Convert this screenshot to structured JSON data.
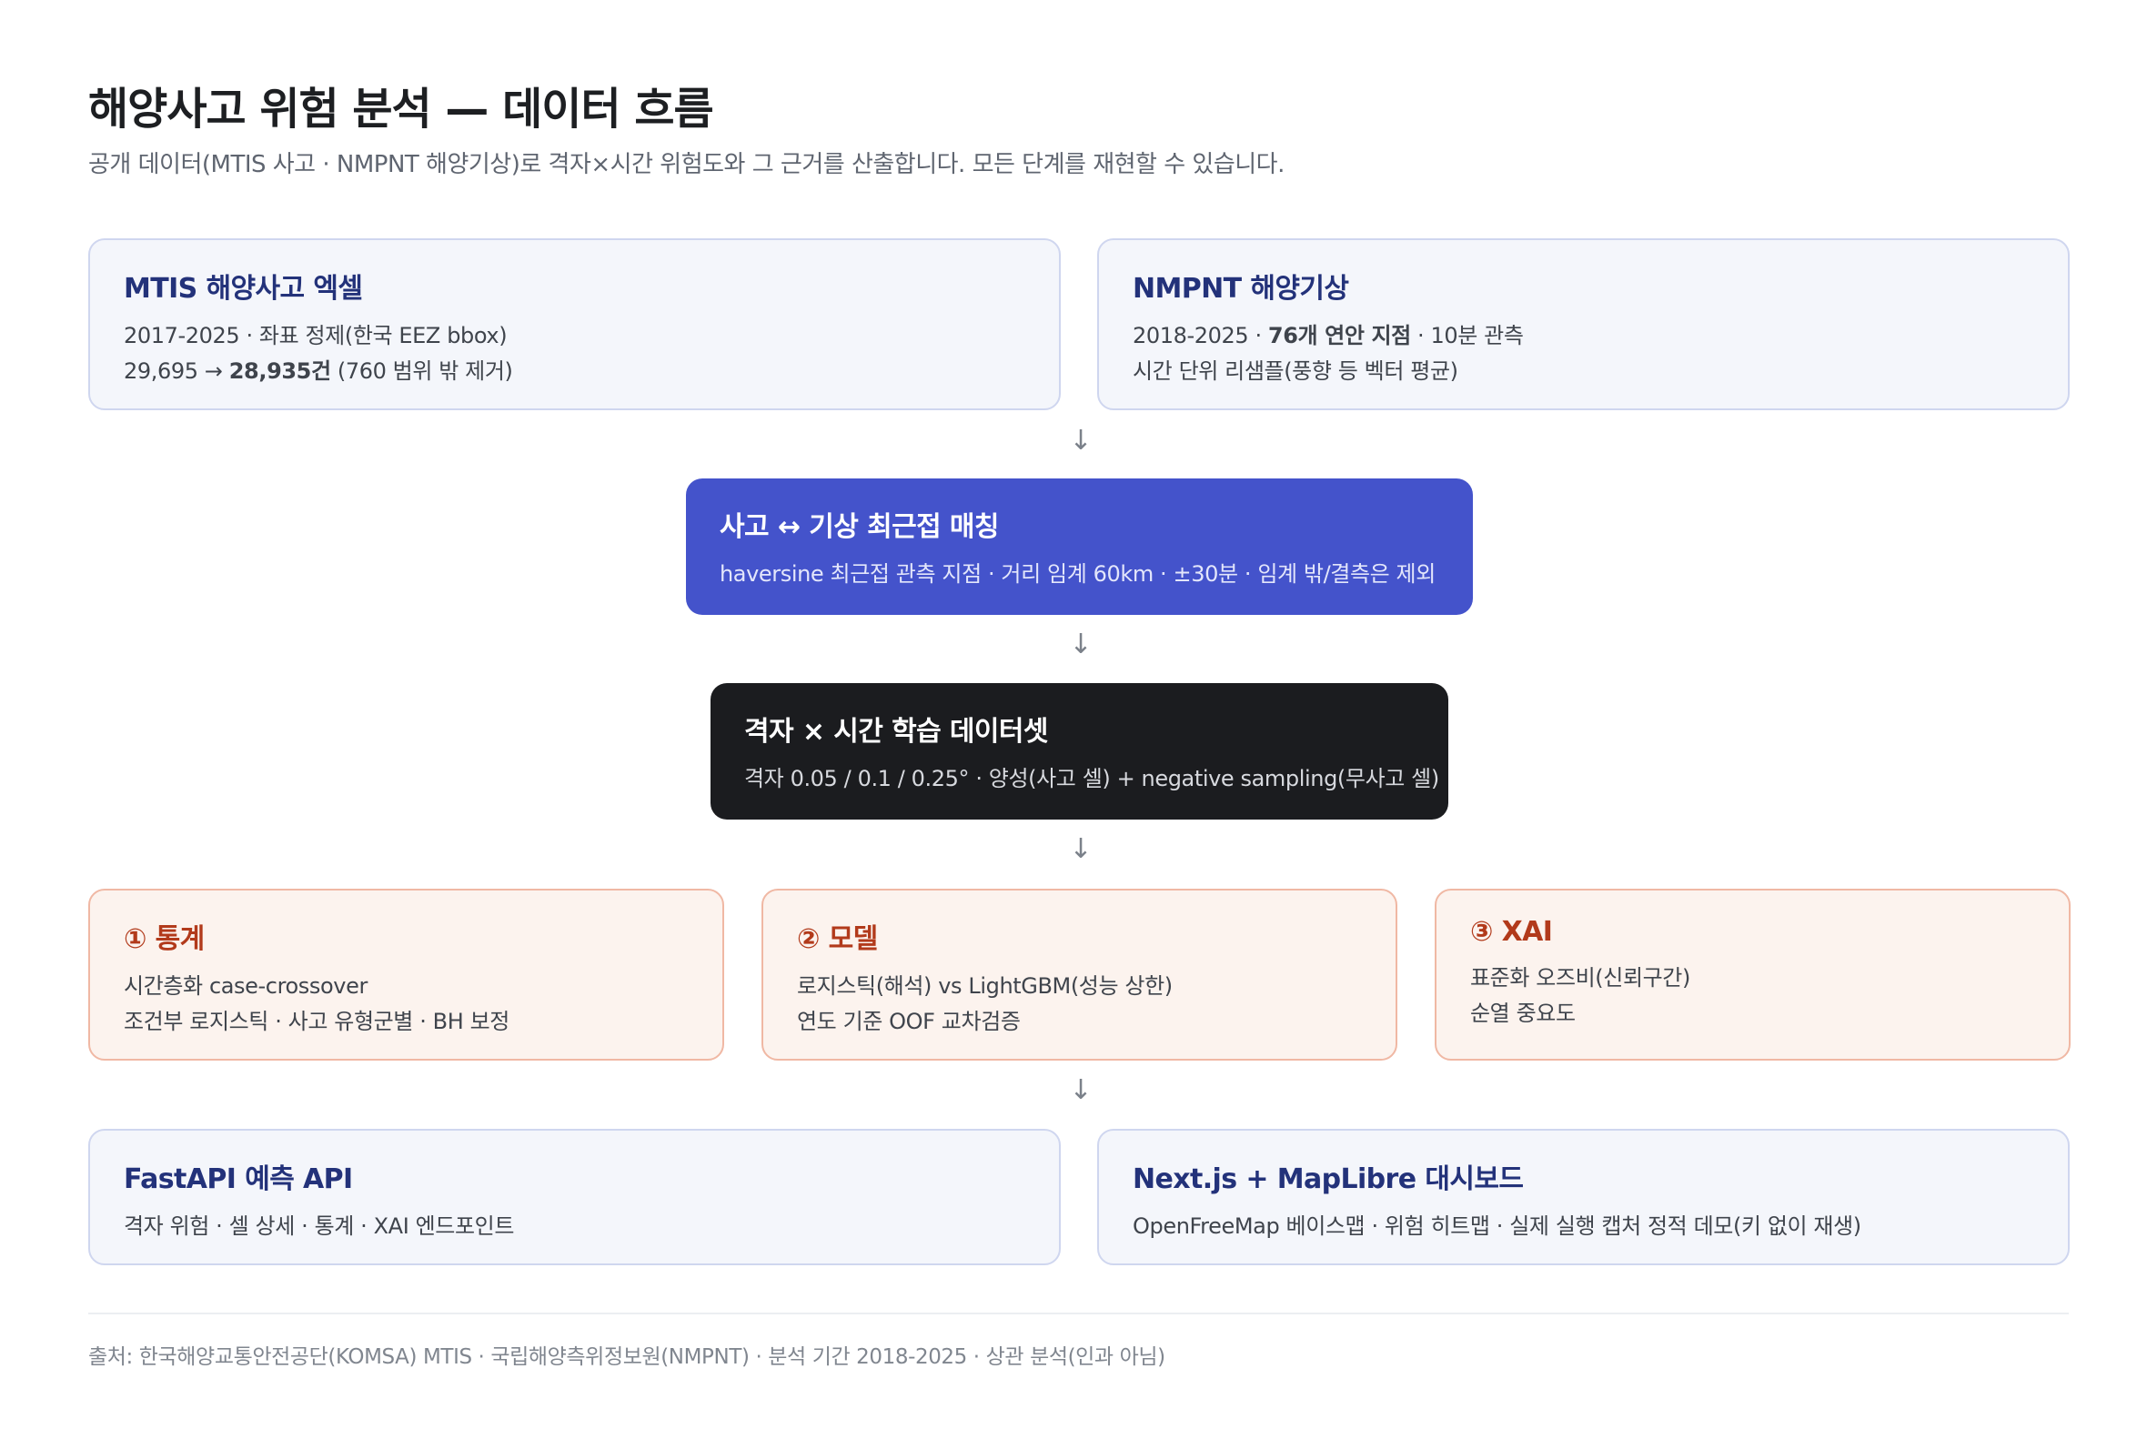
{
  "title": "해양사고 위험 분석 — 데이터 흐름",
  "subtitle": "공개 데이터(MTIS 사고 · NMPNT 해양기상)로 격자×시간 위험도와 그 근거를 산출합니다. 모든 단계를 재현할 수 있습니다.",
  "sources": {
    "mtis": {
      "title": "MTIS 해양사고 엑셀",
      "line1": "2017-2025 · 좌표 정제(한국 EEZ bbox)",
      "line2_pre": "29,695 → ",
      "line2_bold": "28,935건",
      "line2_post": " (760 범위 밖 제거)"
    },
    "nmpnt": {
      "title": "NMPNT 해양기상",
      "line1_pre": "2018-2025 · ",
      "line1_bold": "76개 연안 지점",
      "line1_post": " · 10분 관측",
      "line2": "시간 단위 리샘플(풍향 등 벡터 평균)"
    }
  },
  "match": {
    "title": "사고 ↔ 기상 최근접 매칭",
    "desc": "haversine 최근접 관측 지점 · 거리 임계 60km · ±30분 · 임계 밖/결측은 제외"
  },
  "dataset": {
    "title": "격자 × 시간 학습 데이터셋",
    "desc": "격자 0.05 / 0.1 / 0.25° · 양성(사고 셀) + negative sampling(무사고 셀)"
  },
  "analysis": [
    {
      "title": "① 통계",
      "line1": "시간층화 case-crossover",
      "line2": "조건부 로지스틱 · 사고 유형군별 · BH 보정"
    },
    {
      "title": "② 모델",
      "line1": "로지스틱(해석) vs LightGBM(성능 상한)",
      "line2": "연도 기준 OOF 교차검증"
    },
    {
      "title": "③ XAI",
      "line1": "표준화 오즈비(신뢰구간)",
      "line2": "순열 중요도"
    }
  ],
  "outputs": {
    "api": {
      "title": "FastAPI 예측 API",
      "desc": "격자 위험 · 셀 상세 · 통계 · XAI 엔드포인트"
    },
    "dashboard": {
      "title": "Next.js + MapLibre 대시보드",
      "desc": "OpenFreeMap 베이스맵 · 위험 히트맵 · 실제 실행 캡처 정적 데모(키 없이 재생)"
    }
  },
  "arrow_glyph": "↓",
  "footer": "출처: 한국해양교통안전공단(KOMSA) MTIS · 국립해양측위정보원(NMPNT) · 분석 기간 2018-2025 · 상관 분석(인과 아님)",
  "colors": {
    "source_bg": "#f4f6fb",
    "source_border": "#cfd6ef",
    "source_title": "#23327a",
    "match_bg": "#4453cb",
    "dataset_bg": "#1b1c1f",
    "analysis_bg": "#fcf3ee",
    "analysis_border": "#f0b8a4",
    "analysis_title": "#b23a1b"
  }
}
